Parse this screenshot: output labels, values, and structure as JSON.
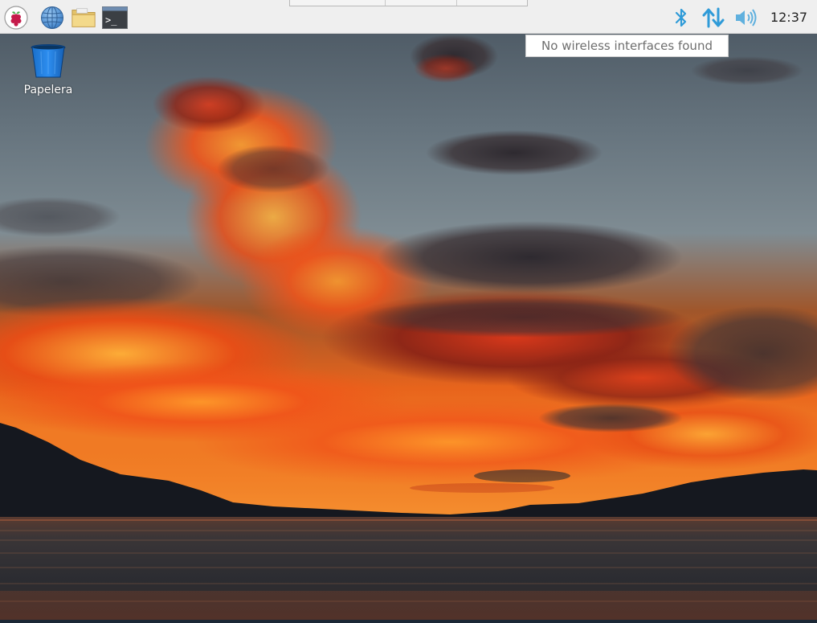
{
  "taskbar": {
    "launchers": [
      {
        "name": "raspberry-menu-icon"
      },
      {
        "name": "web-browser-icon"
      },
      {
        "name": "file-manager-icon"
      },
      {
        "name": "terminal-icon",
        "glyph": ">_"
      }
    ],
    "tray": {
      "bluetooth_icon": "bluetooth-icon",
      "network_icon": "network-updown-icon",
      "volume_icon": "volume-icon",
      "accent_color": "#2f9bd8"
    },
    "clock": "12:37"
  },
  "tooltip": {
    "text": "No wireless interfaces found"
  },
  "desktop": {
    "icons": [
      {
        "label": "Papelera",
        "icon": "trash-icon"
      }
    ]
  },
  "wallpaper": {
    "description_colors": {
      "sky_top": "#4a5866",
      "sky_mid": "#7a8a93",
      "cloud_orange": "#f36b17",
      "cloud_red": "#c23318",
      "mountain": "#141820",
      "water": "#2c2d33"
    }
  }
}
